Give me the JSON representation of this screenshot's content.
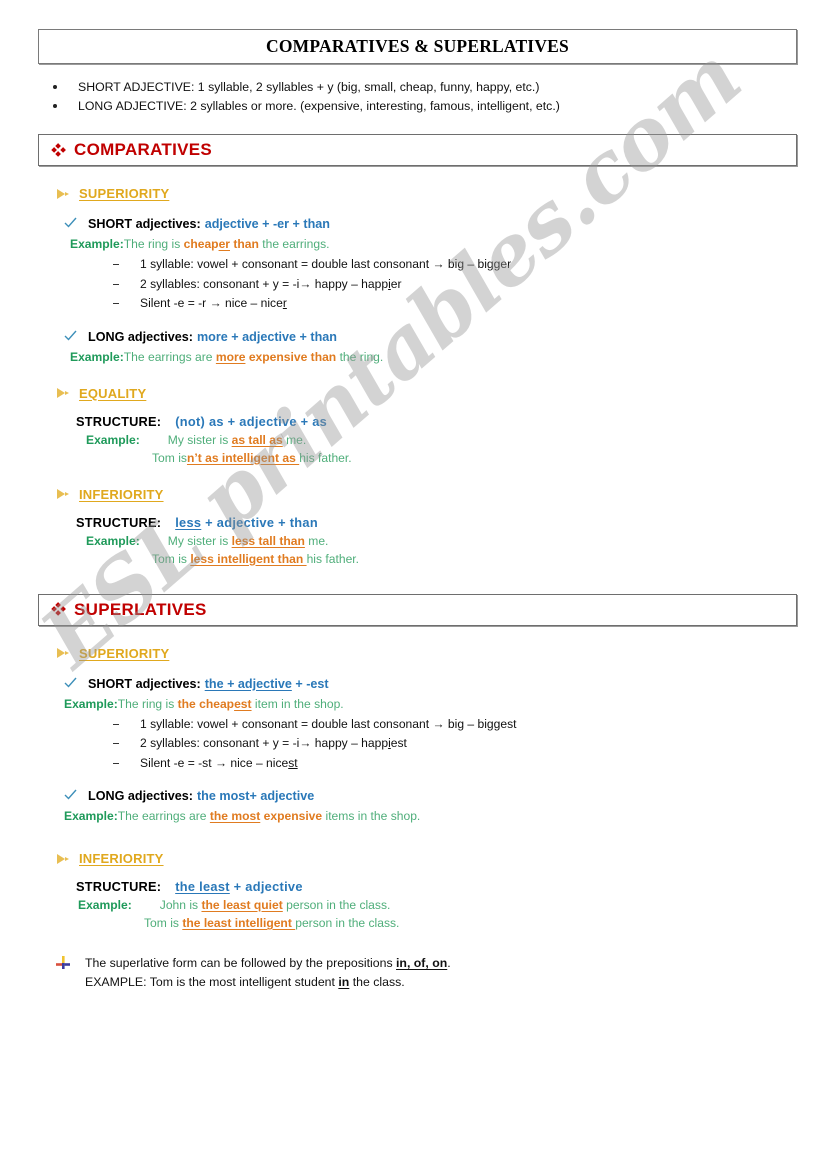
{
  "document": {
    "title": "COMPARATIVES & SUPERLATIVES",
    "watermark": "ESL printables.com"
  },
  "colors": {
    "section_red": "#c00000",
    "subhead_gold": "#e0a81e",
    "formula_blue": "#2a78b8",
    "example_green": "#1f9a5a",
    "sentence_green": "#4fae7a",
    "highlight_orange": "#e07b20"
  },
  "intro": {
    "bullets": [
      "SHORT ADJECTIVE: 1 syllable, 2 syllables + y (big, small, cheap, funny, happy, etc.)",
      "LONG ADJECTIVE: 2 syllables or more. (expensive, interesting, famous, intelligent, etc.)"
    ]
  },
  "comparatives": {
    "heading": "COMPARATIVES",
    "superiority": {
      "label": "SUPERIORITY",
      "short": {
        "kind": "SHORT adjectives:",
        "formula": "adjective + -er + than",
        "example_label": "Example:",
        "ex_pre": "The ring is ",
        "ex_hl_a": "cheap",
        "ex_hl_b": "er",
        "ex_hl_c": " than",
        "ex_post": " the earrings.",
        "rules": [
          {
            "pre": "1 syllable: vowel + consonant = double last consonant → big – bi",
            "ul": "gg",
            "post": "er"
          },
          {
            "pre": "2 syllables: consonant + y = -i→ happy – happ",
            "ul": "i",
            "post": "er"
          },
          {
            "pre": "Silent -e = -r → nice – nice",
            "ul": "r",
            "post": ""
          }
        ]
      },
      "long": {
        "kind": "LONG adjectives:",
        "formula": "more + adjective + than",
        "example_label": "Example:",
        "ex_pre": "The earrings are ",
        "ex_hl_a": "more",
        "ex_hl_c": " expensive than",
        "ex_post": " the ring."
      }
    },
    "equality": {
      "label": "EQUALITY",
      "structure_label": "STRUCTURE:",
      "formula": "(not) as  +  adjective  +  as",
      "example_label": "Example:",
      "line1_pre": "My sister is ",
      "line1_hl": "as tall as",
      "line1_post": " me.",
      "line2_pre": "Tom is",
      "line2_hl": "n’t as intelligent as ",
      "line2_post": "his father."
    },
    "inferiority": {
      "label": "INFERIORITY",
      "structure_label": "STRUCTURE:",
      "formula_ul": "less",
      "formula_rest": "  +  adjective  +  than",
      "example_label": "Example:",
      "line1_pre": "My sister is ",
      "line1_hl": "less tall than",
      "line1_post": " me.",
      "line2_pre": "Tom is ",
      "line2_hl": "less intelligent than ",
      "line2_post": "his father."
    }
  },
  "superlatives": {
    "heading": "SUPERLATIVES",
    "superiority": {
      "label": "SUPERIORITY",
      "short": {
        "kind": "SHORT adjectives:",
        "formula_ul": "the + adjective",
        "formula_rest": " + -est",
        "example_label": "Example:",
        "ex_pre": "The ring is ",
        "ex_hl_a": "the cheap",
        "ex_hl_b": "est",
        "ex_post": " item in the shop.",
        "rules": [
          {
            "pre": "1 syllable: vowel + consonant = double last consonant → big – bi",
            "ul": "gg",
            "post": "est"
          },
          {
            "pre": "2 syllables: consonant + y = -i→ happy – happ",
            "ul": "i",
            "post": "est"
          },
          {
            "pre": "Silent -e = -st → nice – nice",
            "ul": "st",
            "post": ""
          }
        ]
      },
      "long": {
        "kind": "LONG adjectives:",
        "formula": "the most+ adjective",
        "example_label": "Example:",
        "ex_pre": "The earrings are ",
        "ex_hl_a": "the most",
        "ex_hl_c": " expensive",
        "ex_post": " items in the shop."
      }
    },
    "inferiority": {
      "label": "INFERIORITY",
      "structure_label": "STRUCTURE:",
      "formula_ul": "the least",
      "formula_rest": "  +  adjective",
      "example_label": "Example:",
      "line1_pre": "John is ",
      "line1_hl": "the least quiet",
      "line1_post": " person in the class.",
      "line2_pre": "Tom is ",
      "line2_hl": "the least intelligent ",
      "line2_post": "person in the class."
    }
  },
  "note": {
    "line1_pre": "The superlative form can be followed by the prepositions ",
    "line1_bold": "in, of, on",
    "line1_post": ".",
    "line2_pre": "EXAMPLE: Tom is the most intelligent student ",
    "line2_bold": "in",
    "line2_post": " the class."
  }
}
